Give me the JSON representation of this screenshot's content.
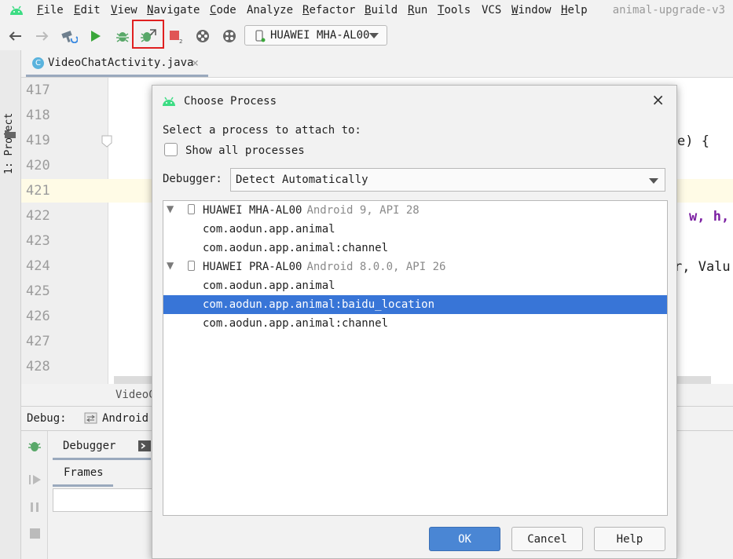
{
  "menu": {
    "items": [
      {
        "label": "File",
        "mnemonic": "F",
        "rest": "ile"
      },
      {
        "label": "Edit",
        "mnemonic": "E",
        "rest": "dit"
      },
      {
        "label": "View",
        "mnemonic": "V",
        "rest": "iew"
      },
      {
        "label": "Navigate",
        "mnemonic": "N",
        "rest": "avigate"
      },
      {
        "label": "Code",
        "mnemonic": "C",
        "rest": "ode"
      },
      {
        "label": "Analyze",
        "mnemonic": "",
        "rest": "Analyze"
      },
      {
        "label": "Refactor",
        "mnemonic": "R",
        "rest": "efactor"
      },
      {
        "label": "Build",
        "mnemonic": "B",
        "rest": "uild"
      },
      {
        "label": "Run",
        "mnemonic": "R",
        "rest": "un"
      },
      {
        "label": "Tools",
        "mnemonic": "T",
        "rest": "ools"
      },
      {
        "label": "VCS",
        "mnemonic": "",
        "rest": "VCS"
      },
      {
        "label": "Window",
        "mnemonic": "W",
        "rest": "indow"
      },
      {
        "label": "Help",
        "mnemonic": "H",
        "rest": "elp"
      }
    ],
    "project_title": "animal-upgrade-v3"
  },
  "toolbar": {
    "device": "HUAWEI MHA-AL00",
    "icons": [
      "back-icon",
      "forward-icon",
      "hammer-build-icon",
      "run-icon",
      "debug-icon",
      "attach-debugger-icon",
      "stop-icon",
      "sync-icon",
      "sdk-icon"
    ]
  },
  "sidebar": {
    "project_label": "1: Project"
  },
  "tabs": [
    {
      "label": "VideoChatActivity.java"
    }
  ],
  "editor": {
    "line_numbers": [
      "417",
      "418",
      "419",
      "420",
      "421",
      "422",
      "423",
      "424",
      "425",
      "426",
      "427",
      "428"
    ],
    "code_fragments": {
      "line419": "e) {",
      "line422": "w, h,",
      "line424": "r, Valu"
    }
  },
  "bottom": {
    "file_tab": "VideoC",
    "debug_label": "Debug:",
    "debug_config": "Android",
    "debugger_tab": "Debugger",
    "frames_tab": "Frames"
  },
  "dialog": {
    "title": "Choose Process",
    "prompt": "Select a process to attach to:",
    "show_all_label": "Show all processes",
    "show_all_checked": false,
    "debugger_label": "Debugger:",
    "debugger_value": "Detect Automatically",
    "devices": [
      {
        "name": "HUAWEI MHA-AL00",
        "version": "Android 9, API 28",
        "processes": [
          "com.aodun.app.animal",
          "com.aodun.app.animal:channel"
        ]
      },
      {
        "name": "HUAWEI PRA-AL00",
        "version": "Android 8.0.0, API 26",
        "processes": [
          "com.aodun.app.animal",
          "com.aodun.app.animal:baidu_location",
          "com.aodun.app.animal:channel"
        ]
      }
    ],
    "selected_process": "com.aodun.app.animal:baidu_location",
    "buttons": {
      "ok": "OK",
      "cancel": "Cancel",
      "help": "Help"
    }
  },
  "colors": {
    "selection": "#3875d7",
    "ok_button": "#4a86d4",
    "highlight_box": "#e02020",
    "android_green": "#3ddc84"
  }
}
